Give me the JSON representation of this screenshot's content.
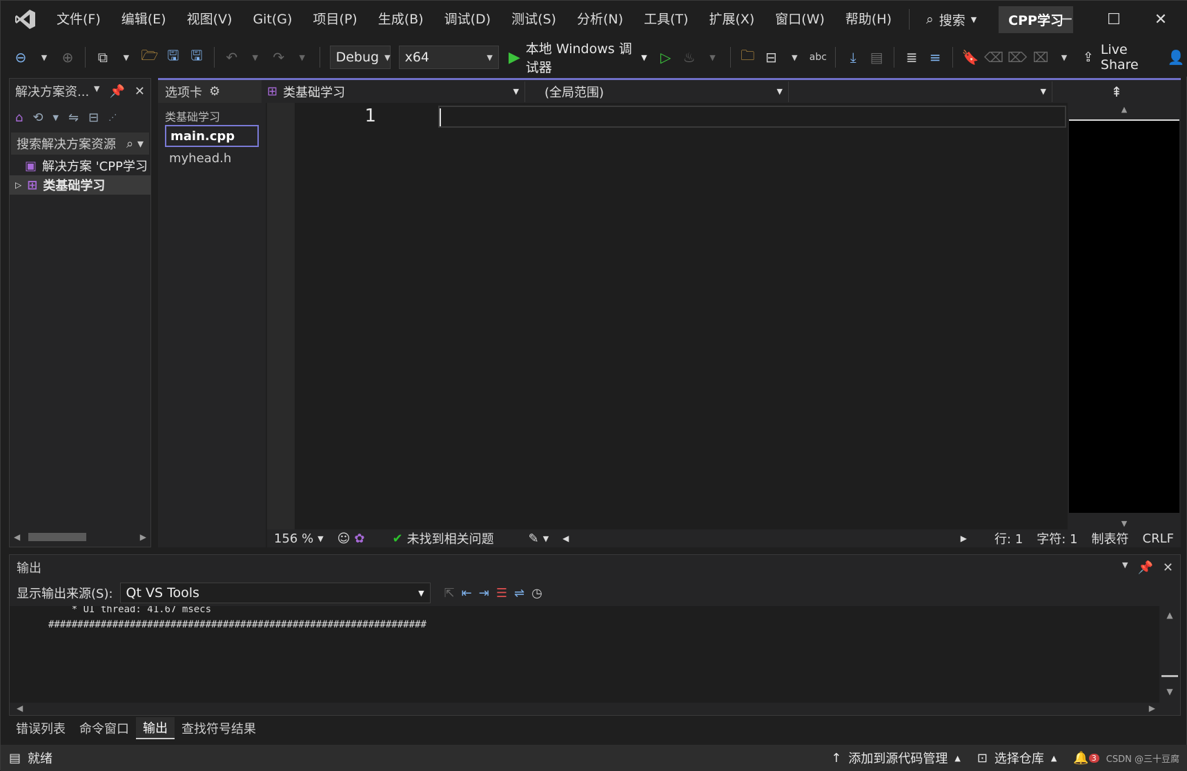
{
  "menu": {
    "items": [
      "文件(F)",
      "编辑(E)",
      "视图(V)",
      "Git(G)",
      "项目(P)",
      "生成(B)",
      "调试(D)",
      "测试(S)",
      "分析(N)",
      "工具(T)",
      "扩展(X)",
      "窗口(W)",
      "帮助(H)"
    ],
    "search_label": "搜索",
    "project_badge": "CPP学习"
  },
  "toolbar": {
    "config": "Debug",
    "platform": "x64",
    "run_label": "本地 Windows 调试器",
    "live_share": "Live Share"
  },
  "solution_explorer": {
    "title": "解决方案资...",
    "search_placeholder": "搜索解决方案资源",
    "tree": [
      {
        "label": "解决方案 'CPP学习"
      },
      {
        "label": "类基础学习"
      }
    ]
  },
  "editor": {
    "tabs_label": "选项卡",
    "project_combo": "类基础学习",
    "scope_combo": "(全局范围)",
    "member_combo": "",
    "file_group": "类基础学习",
    "files": [
      "main.cpp",
      "myhead.h"
    ],
    "line_number": "1",
    "zoom": "156 %",
    "issues": "未找到相关问题",
    "line": "行: 1",
    "char": "字符: 1",
    "indent": "制表符",
    "eol": "CRLF"
  },
  "output": {
    "title": "输出",
    "source_label": "显示输出来源(S):",
    "source_value": "Qt VS Tools",
    "lines": [
      "    * UI thread: 41.67 msecs",
      "#################################################################"
    ]
  },
  "bottom_tabs": [
    "错误列表",
    "命令窗口",
    "输出",
    "查找符号结果"
  ],
  "status": {
    "ready": "就绪",
    "source_control": "添加到源代码管理",
    "repo": "选择仓库",
    "notifications": "3",
    "watermark": "CSDN @三十豆腐"
  },
  "colors": {
    "accent": "#6f6fc7",
    "run_green": "#3cc23c",
    "toolbar_blue": "#7fb2ec"
  }
}
